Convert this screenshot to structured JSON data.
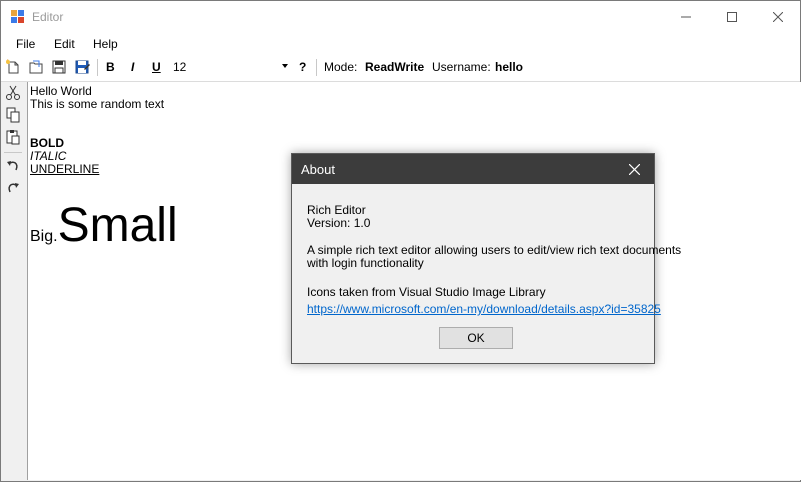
{
  "window": {
    "title": "Editor"
  },
  "menu": {
    "file": "File",
    "edit": "Edit",
    "help": "Help"
  },
  "toolbar": {
    "bold_label": "B",
    "italic_label": "I",
    "underline_label": "U",
    "font_size": "12",
    "help_label": "?",
    "mode_label": "Mode:",
    "mode_value": "ReadWrite",
    "username_label": "Username:",
    "username_value": "hello"
  },
  "editor": {
    "line1": "Hello World",
    "line2": "This is some random text",
    "bold": "BOLD",
    "italic": "ITALIC",
    "underline": "UNDERLINE",
    "big": "Big.",
    "small": "Small"
  },
  "about": {
    "title": "About",
    "app_name": "Rich Editor",
    "version": "Version: 1.0",
    "desc_line1": "A simple rich text editor allowing users to edit/view rich text documents",
    "desc_line2": "with login functionality",
    "icons_credit": "Icons taken from Visual Studio Image Library",
    "link": "https://www.microsoft.com/en-my/download/details.aspx?id=35825",
    "ok_label": "OK"
  },
  "colors": {
    "dialog_title_bg": "#3c3c3c",
    "link": "#0066cc",
    "window_bg": "#f0f0f0"
  }
}
